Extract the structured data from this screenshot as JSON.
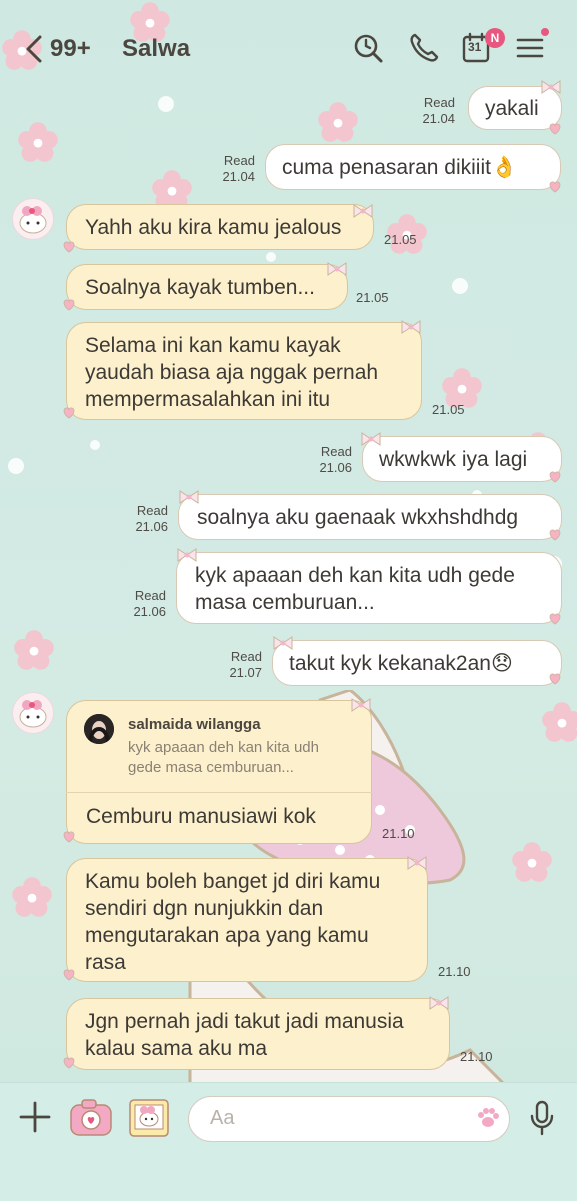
{
  "header": {
    "unread_count": "99+",
    "contact_name": "Salwa",
    "calendar_day": "31",
    "calendar_badge": "N"
  },
  "messages": [
    {
      "dir": "out",
      "text": "yakali",
      "read": "Read",
      "time": "21.04"
    },
    {
      "dir": "out",
      "text": "cuma penasaran dikiiit",
      "emoji": "👌",
      "read": "Read",
      "time": "21.04"
    },
    {
      "dir": "in",
      "text": "Yahh aku kira kamu jealous",
      "time": "21.05"
    },
    {
      "dir": "in",
      "text": "Soalnya kayak tumben...",
      "time": "21.05"
    },
    {
      "dir": "in",
      "text": "Selama ini kan kamu kayak\nyaudah biasa aja nggak pernah\nmempermasalahkan ini itu",
      "time": "21.05"
    },
    {
      "dir": "out",
      "text": "wkwkwk iya lagi",
      "read": "Read",
      "time": "21.06"
    },
    {
      "dir": "out",
      "text": "soalnya aku gaenaak wkxhshdhdg",
      "read": "Read",
      "time": "21.06"
    },
    {
      "dir": "out",
      "text": "kyk apaaan deh kan kita udh gede\nmasa cemburuan...",
      "read": "Read",
      "time": "21.06"
    },
    {
      "dir": "out",
      "text": "takut kyk kekanak2an",
      "emoji": "😞",
      "read": "Read",
      "time": "21.07"
    },
    {
      "dir": "in",
      "reply_to": {
        "name": "salmaida wilangga",
        "text": "kyk apaaan deh kan kita udh\ngede masa cemburuan..."
      },
      "text": "Cemburu manusiawi kok",
      "time": "21.10"
    },
    {
      "dir": "in",
      "text": "Kamu boleh banget jd diri kamu\nsendiri dgn nunjukkin dan\nmengutarakan apa yang kamu\nrasa",
      "time": "21.10"
    },
    {
      "dir": "in",
      "text": "Jgn pernah jadi takut jadi manusia\nkalau sama aku ma",
      "time": "21.10"
    }
  ],
  "composer": {
    "placeholder": "Aa"
  },
  "colors": {
    "background": "#cfe9e2",
    "incoming_bubble": "#fdf0cc",
    "outgoing_bubble": "#ffffff",
    "accent_pink": "#e8577f"
  },
  "icons": [
    "back-icon",
    "search-clock-icon",
    "phone-icon",
    "calendar-icon",
    "menu-icon",
    "plus-icon",
    "camera-icon",
    "photo-icon",
    "paw-icon",
    "mic-icon"
  ]
}
